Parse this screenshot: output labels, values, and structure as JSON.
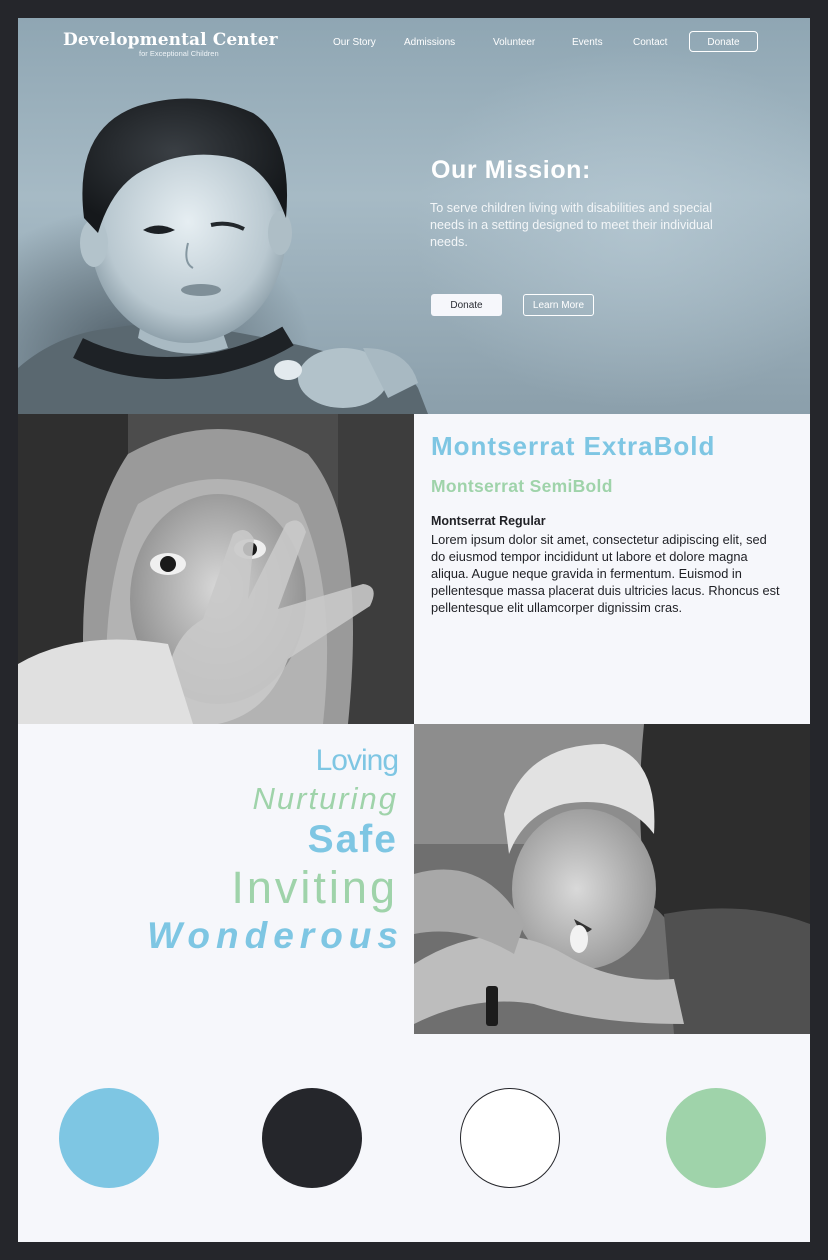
{
  "brand": {
    "title": "Developmental Center",
    "subtitle": "for Exceptional Children"
  },
  "nav": {
    "items": [
      {
        "label": "Our Story"
      },
      {
        "label": "Admissions"
      },
      {
        "label": "Volunteer"
      },
      {
        "label": "Events"
      },
      {
        "label": "Contact"
      }
    ],
    "donate_label": "Donate"
  },
  "hero": {
    "title": "Our Mission:",
    "body": "To serve children living with disabilities and special needs in a setting designed to meet their individual needs.",
    "primary_button": "Donate",
    "secondary_button": "Learn More",
    "photo_icon": "boy-winking-photo"
  },
  "typography": {
    "heading1": "Montserrat ExtraBold",
    "heading2": "Montserrat SemiBold",
    "heading3": "Montserrat Regular",
    "body": "Lorem ipsum dolor sit amet, consectetur adipiscing elit, sed do eiusmod tempor incididunt ut labore et dolore magna aliqua. Augue neque gravida in fermentum. Euismod in pellentesque massa placerat duis ultricies lacus. Rhoncus est pellentesque elit ullamcorper dignissim cras.",
    "photo_icon": "girl-reaching-photo"
  },
  "words": [
    "Loving",
    "Nurturing",
    "Safe",
    "Inviting",
    "Wonderous"
  ],
  "boy_photo_icon": "boy-drinking-photo",
  "colors": {
    "page_bg": "#25262b",
    "blue": "#7ec6e3",
    "dark": "#25262b",
    "white": "#ffffff",
    "green": "#9fd3aa",
    "panel": "#f6f7fb"
  },
  "swatches": [
    {
      "name": "blue",
      "color": "#7ec6e3"
    },
    {
      "name": "dark",
      "color": "#25262b"
    },
    {
      "name": "white",
      "color": "#ffffff"
    },
    {
      "name": "green",
      "color": "#9fd3aa"
    }
  ]
}
